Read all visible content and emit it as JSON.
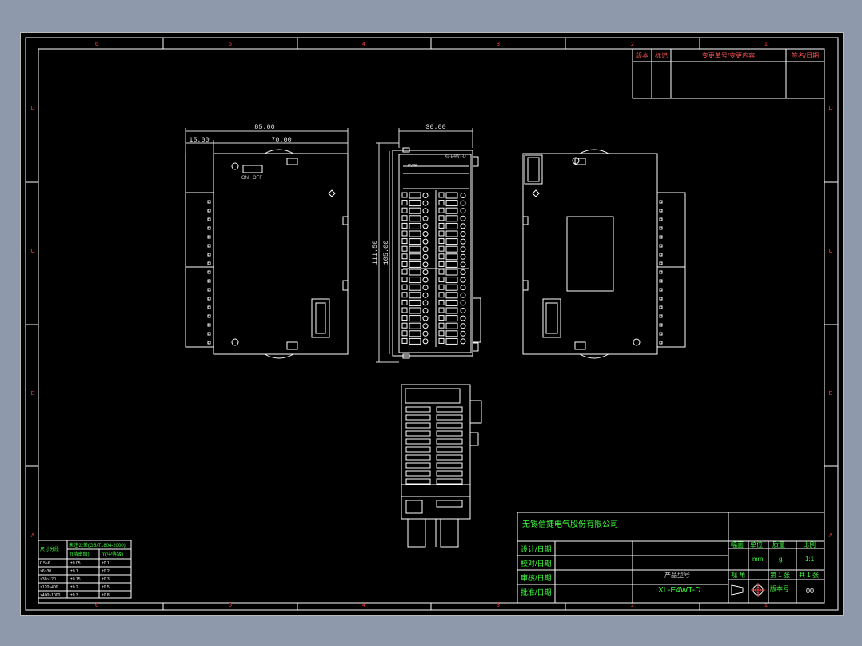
{
  "grid": {
    "columns_top": [
      "6",
      "5",
      "4",
      "3",
      "2",
      "1"
    ],
    "columns_bottom": [
      "6",
      "5",
      "4",
      "3",
      "2",
      "1"
    ],
    "rows_left": [
      "D",
      "C",
      "B",
      "A"
    ],
    "rows_right": [
      "D",
      "C",
      "B",
      "A"
    ]
  },
  "revision_table": {
    "headers": [
      "版本",
      "标记",
      "变更单号/变更内容",
      "签名/日期"
    ]
  },
  "dimensions": {
    "overall_width": "85.00",
    "offset_left": "15.00",
    "body_width": "70.00",
    "side_width": "36.00",
    "overall_height": "111.50",
    "body_height": "105.00"
  },
  "device": {
    "model_label": "XL-E4WT-D",
    "pwr_label": "PWR",
    "switch_on": "ON",
    "switch_off": "OFF"
  },
  "title_block": {
    "company": "无锡信捷电气股份有限公司",
    "rows": [
      "设计/日期",
      "校对/日期",
      "审核/日期",
      "批准/日期"
    ],
    "headers": [
      "幅面",
      "单位",
      "质量",
      "比例"
    ],
    "values": [
      "",
      "mm",
      "g",
      "1:1"
    ],
    "product_model_label": "产品型号",
    "product_model": "XL-E4WT-D",
    "view_label": "视 角",
    "sheet_no": "第 1 张",
    "sheet_total": "共 1 张",
    "version_label": "版本号",
    "version_value": "00"
  },
  "tolerance_table": {
    "header_col1": "尺寸分段",
    "header_top": "未注公差(GB/T1804-2000)",
    "header_sub1": "f(精密级)",
    "header_sub2": "m(中等级)",
    "rows": [
      [
        "0.5~6",
        "±0.05",
        "±0.1"
      ],
      [
        ">6~30",
        "±0.1",
        "±0.2"
      ],
      [
        ">30~120",
        "±0.15",
        "±0.3"
      ],
      [
        ">120~400",
        "±0.2",
        "±0.5"
      ],
      [
        ">400~1000",
        "±0.3",
        "±0.8"
      ]
    ]
  }
}
